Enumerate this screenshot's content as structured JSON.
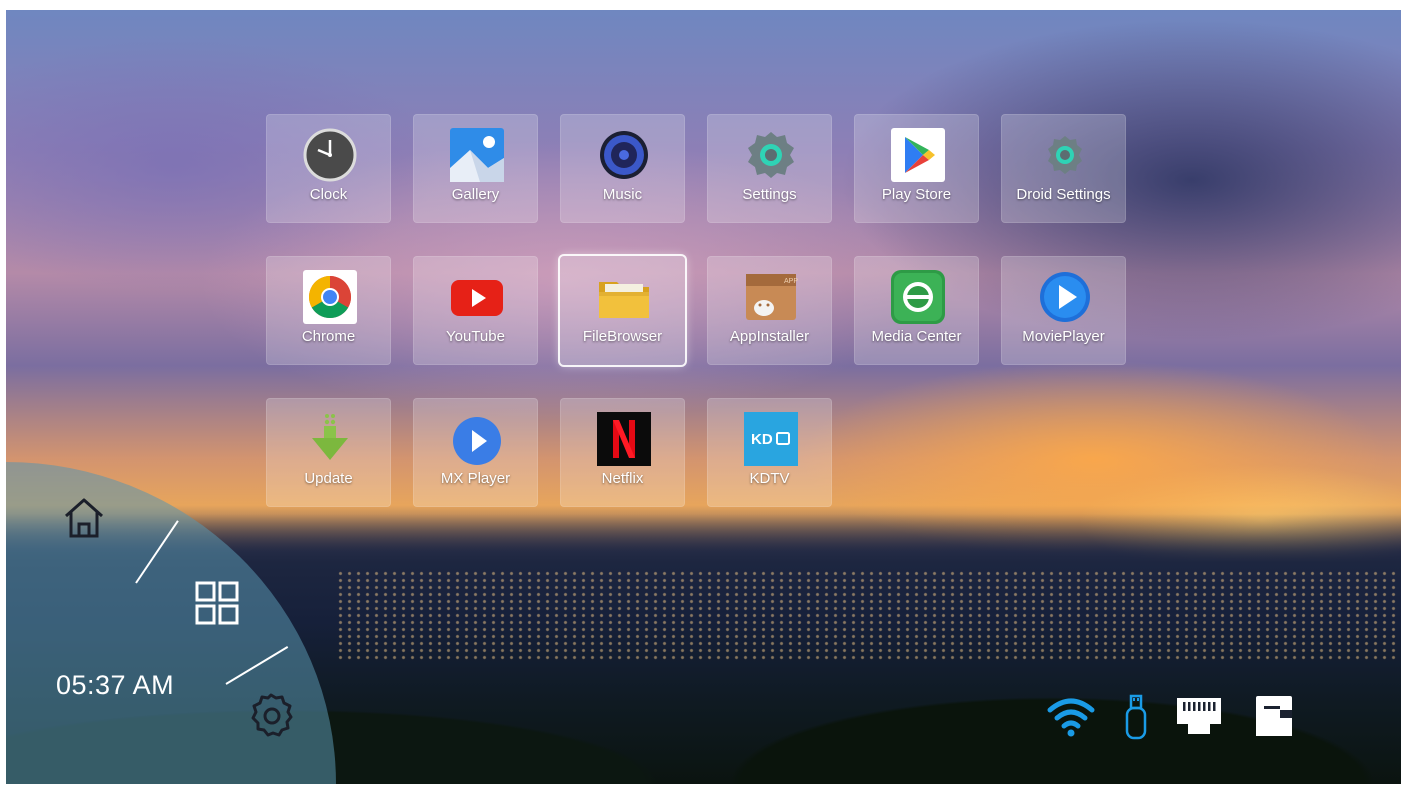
{
  "apps": [
    {
      "label": "Clock",
      "icon": "clock-icon"
    },
    {
      "label": "Gallery",
      "icon": "gallery-icon"
    },
    {
      "label": "Music",
      "icon": "music-icon"
    },
    {
      "label": "Settings",
      "icon": "settings-gear-icon"
    },
    {
      "label": "Play Store",
      "icon": "play-store-icon"
    },
    {
      "label": "Droid Settings",
      "icon": "droid-settings-icon"
    },
    {
      "label": "Chrome",
      "icon": "chrome-icon"
    },
    {
      "label": "YouTube",
      "icon": "youtube-icon"
    },
    {
      "label": "FileBrowser",
      "icon": "folder-icon"
    },
    {
      "label": "AppInstaller",
      "icon": "app-installer-icon"
    },
    {
      "label": "Media Center",
      "icon": "media-center-icon"
    },
    {
      "label": "MoviePlayer",
      "icon": "movie-player-icon"
    },
    {
      "label": "Update",
      "icon": "update-arrow-icon"
    },
    {
      "label": "MX Player",
      "icon": "mx-player-icon"
    },
    {
      "label": "Netflix",
      "icon": "netflix-icon"
    },
    {
      "label": "KDTV",
      "icon": "kdtv-icon"
    }
  ],
  "focused_app": "FileBrowser",
  "launcher": {
    "time": "05:37 AM",
    "home_icon": "home-icon",
    "apps_icon": "apps-grid-icon",
    "settings_icon": "settings-icon"
  },
  "status_bar": {
    "icons": [
      "wifi-icon",
      "usb-drive-icon",
      "ethernet-icon",
      "sd-card-icon"
    ],
    "wifi_color": "#1a9be6"
  }
}
